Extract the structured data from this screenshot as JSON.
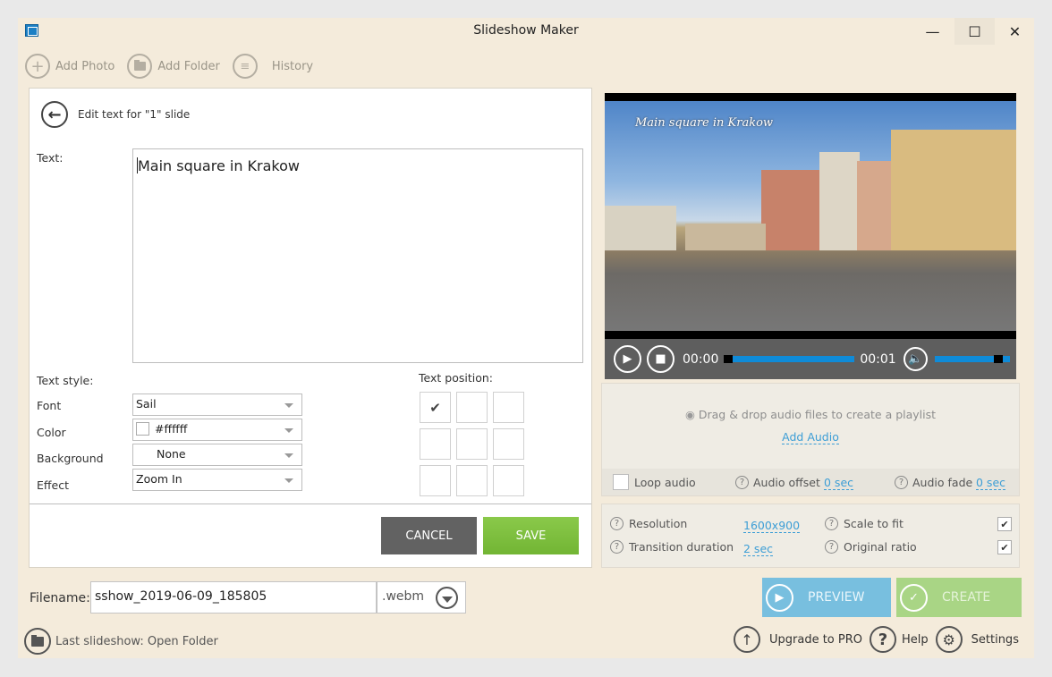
{
  "window": {
    "title": "Slideshow Maker",
    "minimize_icon": "minimize-icon",
    "maximize_icon": "maximize-icon",
    "close_icon": "close-icon"
  },
  "toolbar": {
    "add_photo": "Add Photo",
    "add_folder": "Add Folder",
    "history": "History"
  },
  "editor": {
    "header": "Edit text for \"1\" slide",
    "text_label": "Text:",
    "text_value": "Main square in Krakow",
    "text_style_label": "Text style:",
    "font_label": "Font",
    "font_value": "Sail",
    "color_label": "Color",
    "color_value": "#ffffff",
    "background_label": "Background",
    "background_value": "None",
    "effect_label": "Effect",
    "effect_value": "Zoom In",
    "text_position_label": "Text position:",
    "text_position_selected": "top-left",
    "positions": [
      "top-left",
      "top-center",
      "top-right",
      "middle-left",
      "middle-center",
      "middle-right",
      "bottom-left",
      "bottom-center",
      "bottom-right"
    ],
    "cancel": "CANCEL",
    "save": "SAVE"
  },
  "player": {
    "overlay_text": "Main square in Krakow",
    "current_time": "00:00",
    "total_time": "00:01",
    "progress": 0.0,
    "volume": 0.9,
    "accent": "#0f8bd8"
  },
  "audio": {
    "drop_hint": "Drag & drop audio files to create a playlist",
    "add_audio": "Add Audio",
    "loop_label": "Loop audio",
    "loop_checked": false,
    "offset_label": "Audio offset",
    "offset_value": "0 sec",
    "fade_label": "Audio fade",
    "fade_value": "0 sec"
  },
  "settings": {
    "resolution_label": "Resolution",
    "resolution_value": "1600x900",
    "transition_label": "Transition duration",
    "transition_value": "2 sec",
    "scale_label": "Scale to fit",
    "scale_checked": true,
    "ratio_label": "Original ratio",
    "ratio_checked": true
  },
  "output": {
    "filename_label": "Filename:",
    "filename_value": "sshow_2019-06-09_185805",
    "extension": ".webm",
    "last_slideshow": "Last slideshow: Open Folder",
    "preview": "PREVIEW",
    "create": "CREATE"
  },
  "footer": {
    "upgrade": "Upgrade to PRO",
    "help": "Help",
    "settings": "Settings"
  },
  "colors": {
    "window_bg": "#f4ebdb",
    "save_green": "#7cbf3f",
    "cancel_gray": "#626262",
    "preview_blue": "#78bfdf",
    "create_green": "#a9d585",
    "link_blue": "#3d9ed6"
  }
}
